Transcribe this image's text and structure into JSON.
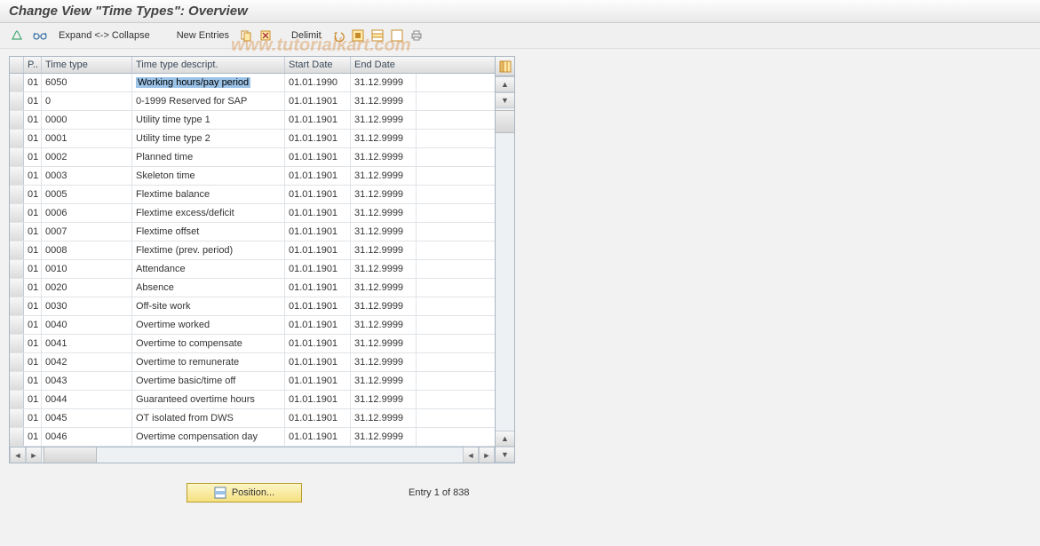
{
  "title": "Change View \"Time Types\": Overview",
  "watermark": "www.tutorialkart.com",
  "toolbar": {
    "expand": "Expand <-> Collapse",
    "new_entries": "New Entries",
    "delimit": "Delimit"
  },
  "columns": {
    "sel": "",
    "p": "P..",
    "time_type": "Time type",
    "desc": "Time type descript.",
    "start": "Start Date",
    "end": "End Date"
  },
  "rows": [
    {
      "p": "01",
      "tt": "6050",
      "desc": "Working hours/pay period",
      "sd": "01.01.1990",
      "ed": "31.12.9999",
      "hl": true
    },
    {
      "p": "01",
      "tt": "0",
      "desc": "0-1999 Reserved for SAP",
      "sd": "01.01.1901",
      "ed": "31.12.9999"
    },
    {
      "p": "01",
      "tt": "0000",
      "desc": "Utility time type 1",
      "sd": "01.01.1901",
      "ed": "31.12.9999"
    },
    {
      "p": "01",
      "tt": "0001",
      "desc": "Utility time type 2",
      "sd": "01.01.1901",
      "ed": "31.12.9999"
    },
    {
      "p": "01",
      "tt": "0002",
      "desc": "Planned time",
      "sd": "01.01.1901",
      "ed": "31.12.9999"
    },
    {
      "p": "01",
      "tt": "0003",
      "desc": "Skeleton time",
      "sd": "01.01.1901",
      "ed": "31.12.9999"
    },
    {
      "p": "01",
      "tt": "0005",
      "desc": "Flextime balance",
      "sd": "01.01.1901",
      "ed": "31.12.9999"
    },
    {
      "p": "01",
      "tt": "0006",
      "desc": "Flextime excess/deficit",
      "sd": "01.01.1901",
      "ed": "31.12.9999"
    },
    {
      "p": "01",
      "tt": "0007",
      "desc": "Flextime offset",
      "sd": "01.01.1901",
      "ed": "31.12.9999"
    },
    {
      "p": "01",
      "tt": "0008",
      "desc": "Flextime (prev. period)",
      "sd": "01.01.1901",
      "ed": "31.12.9999"
    },
    {
      "p": "01",
      "tt": "0010",
      "desc": "Attendance",
      "sd": "01.01.1901",
      "ed": "31.12.9999"
    },
    {
      "p": "01",
      "tt": "0020",
      "desc": "Absence",
      "sd": "01.01.1901",
      "ed": "31.12.9999"
    },
    {
      "p": "01",
      "tt": "0030",
      "desc": "Off-site work",
      "sd": "01.01.1901",
      "ed": "31.12.9999"
    },
    {
      "p": "01",
      "tt": "0040",
      "desc": "Overtime worked",
      "sd": "01.01.1901",
      "ed": "31.12.9999"
    },
    {
      "p": "01",
      "tt": "0041",
      "desc": "Overtime to compensate",
      "sd": "01.01.1901",
      "ed": "31.12.9999"
    },
    {
      "p": "01",
      "tt": "0042",
      "desc": "Overtime to remunerate",
      "sd": "01.01.1901",
      "ed": "31.12.9999"
    },
    {
      "p": "01",
      "tt": "0043",
      "desc": "Overtime basic/time off",
      "sd": "01.01.1901",
      "ed": "31.12.9999"
    },
    {
      "p": "01",
      "tt": "0044",
      "desc": "Guaranteed overtime hours",
      "sd": "01.01.1901",
      "ed": "31.12.9999"
    },
    {
      "p": "01",
      "tt": "0045",
      "desc": "OT isolated from DWS",
      "sd": "01.01.1901",
      "ed": "31.12.9999"
    },
    {
      "p": "01",
      "tt": "0046",
      "desc": "Overtime compensation day",
      "sd": "01.01.1901",
      "ed": "31.12.9999"
    }
  ],
  "footer": {
    "position": "Position...",
    "entry": "Entry 1 of 838"
  }
}
